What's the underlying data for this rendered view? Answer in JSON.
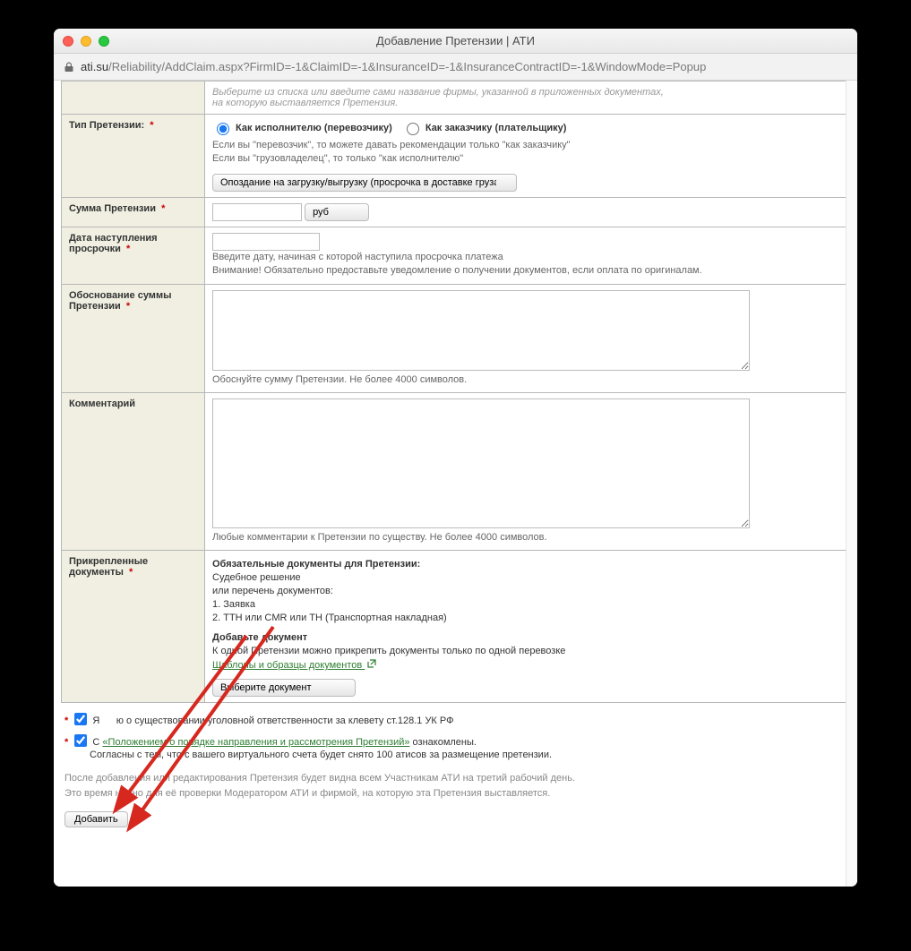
{
  "window": {
    "title": "Добавление Претензии | АТИ",
    "url_host": "ati.su",
    "url_path": "/Reliability/AddClaim.aspx?FirmID=-1&ClaimID=-1&InsuranceID=-1&InsuranceContractID=-1&WindowMode=Popup"
  },
  "row_firm": {
    "hint1": "Выберите из списка или введите сами название фирмы, указанной в приложенных документах,",
    "hint2": "на которую выставляется Претензия."
  },
  "row_type": {
    "label": "Тип Претензии:",
    "opt1": "Как исполнителю (перевозчику)",
    "opt2": "Как заказчику (плательщику)",
    "hint1": "Если вы \"перевозчик\", то можете давать рекомендации только \"как заказчику\"",
    "hint2": "Если вы \"грузовладелец\", то только \"как исполнителю\"",
    "select_value": "Опоздание на загрузку/выгрузку (просрочка в доставке груза)"
  },
  "row_sum": {
    "label": "Сумма Претензии",
    "currency": "руб"
  },
  "row_date": {
    "label1": "Дата наступления",
    "label2": "просрочки",
    "hint1": "Введите дату, начиная с которой наступила просрочка платежа",
    "hint2": "Внимание! Обязательно предоставьте уведомление о получении документов, если оплата по оригиналам."
  },
  "row_reason": {
    "label1": "Обоснование суммы",
    "label2": "Претензии",
    "hint": "Обоснуйте сумму Претензии. Не более 4000 символов."
  },
  "row_comment": {
    "label": "Комментарий",
    "hint": "Любые комментарии к Претензии по существу. Не более 4000 символов."
  },
  "row_docs": {
    "label1": "Прикрепленные",
    "label2": "документы",
    "title1": "Обязательные документы для Претензии:",
    "d1": "Судебное решение",
    "or": "или перечень документов:",
    "d2": "1. Заявка",
    "d3": "2. ТТН или CMR или ТН (Транспортная накладная)",
    "title2": "Добавьте документ",
    "hint": "К одной Претензии можно прикрепить документы только по одной перевозке",
    "templates_link": "Шаблоны и образцы документов ",
    "select_value": "Выберите документ"
  },
  "agree": {
    "chk1_before": "Я",
    "chk1_after": "ю о существовании уголовной ответственности за клевету ст.128.1 УК РФ",
    "chk2_before": "С",
    "chk2_link": "«Положением о порядке направления и рассмотрения Претензий»",
    "chk2_after": " ознакомлены.",
    "chk2_line2": "Согласны с тем, что с вашего виртуального счета будет снято 100 атисов за размещение претензии."
  },
  "footer": {
    "line1": "После добавления или редактирования Претензия будет видна всем Участникам АТИ на третий рабочий день.",
    "line2": "Это время нужно для её проверки Модератором АТИ и фирмой, на которую эта Претензия выставляется.",
    "submit": "Добавить"
  }
}
